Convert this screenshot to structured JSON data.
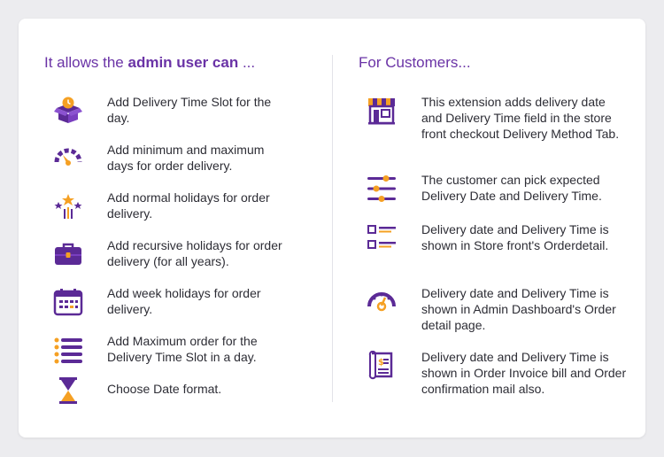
{
  "admin": {
    "heading_prefix": "It allows the ",
    "heading_bold": "admin user can",
    "heading_suffix": " ...",
    "items": [
      {
        "icon": "delivery-box-clock-icon",
        "text": "Add Delivery Time Slot for the day."
      },
      {
        "icon": "speedometer-icon",
        "text": "Add minimum and maximum days for order delivery."
      },
      {
        "icon": "fireworks-icon",
        "text": "Add normal holidays for order delivery."
      },
      {
        "icon": "briefcase-icon",
        "text": "Add recursive holidays for order delivery (for all years)."
      },
      {
        "icon": "calendar-icon",
        "text": "Add week holidays for order delivery."
      },
      {
        "icon": "list-icon",
        "text": "Add Maximum order for the Delivery Time Slot in a day."
      },
      {
        "icon": "hourglass-icon",
        "text": "Choose Date format."
      }
    ]
  },
  "customers": {
    "heading": "For Customers...",
    "items": [
      {
        "icon": "storefront-icon",
        "text": "This extension adds delivery date and Delivery Time field in the store front checkout Delivery Method Tab."
      },
      {
        "icon": "sliders-icon",
        "text": "The customer can pick expected Delivery Date and Delivery Time."
      },
      {
        "icon": "checklist-icon",
        "text": "Delivery date and Delivery Time is shown in Store front's Orderdetail."
      },
      {
        "icon": "dashboard-gauge-icon",
        "text": "Delivery date and Delivery Time is shown in Admin Dashboard's Order detail page."
      },
      {
        "icon": "invoice-icon",
        "text": "Delivery date and Delivery Time is shown in Order Invoice bill and Order confirmation mail also."
      }
    ]
  },
  "colors": {
    "purple": "#5b2a96",
    "orange": "#f5a023",
    "heading": "#6a33a6",
    "text": "#2d2d35"
  }
}
